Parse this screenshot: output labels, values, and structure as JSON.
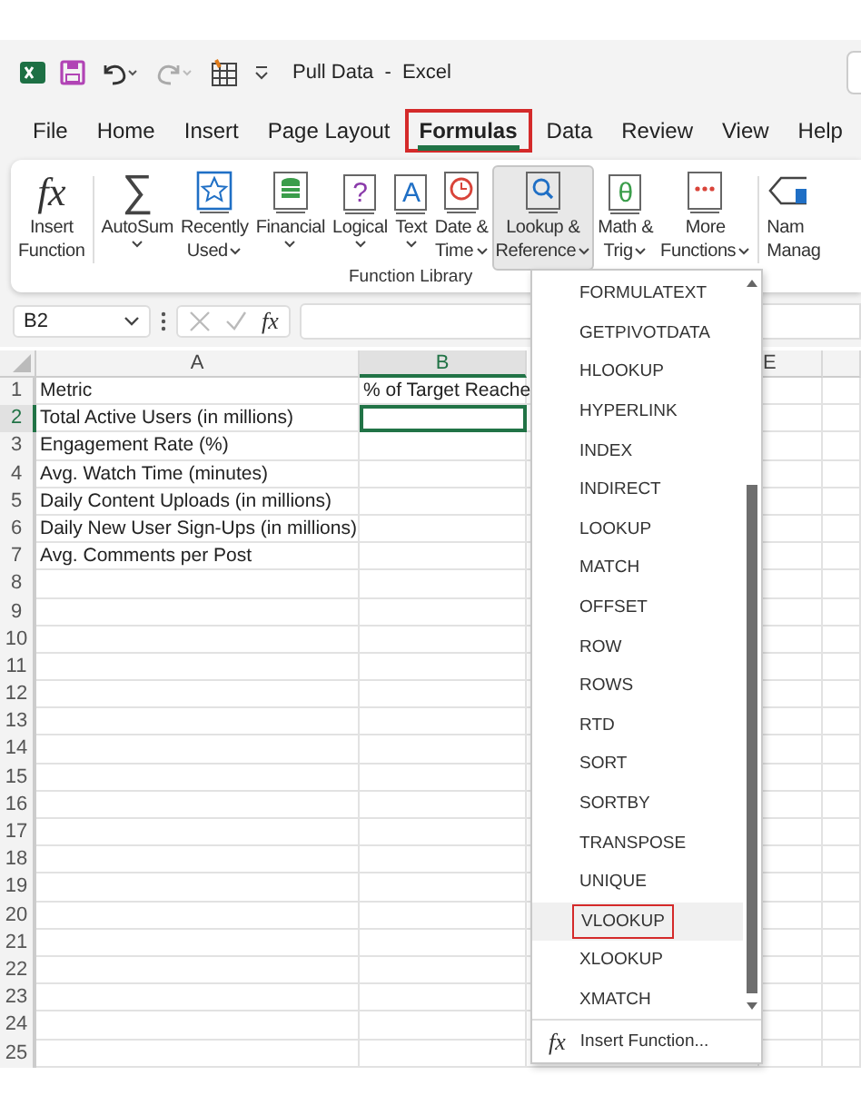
{
  "title_bar": {
    "title": "Pull Data  -  Excel"
  },
  "tabs": [
    {
      "label": "File",
      "selected": false,
      "highlighted": false
    },
    {
      "label": "Home",
      "selected": false,
      "highlighted": false
    },
    {
      "label": "Insert",
      "selected": false,
      "highlighted": false
    },
    {
      "label": "Page Layout",
      "selected": false,
      "highlighted": false
    },
    {
      "label": "Formulas",
      "selected": true,
      "highlighted": true
    },
    {
      "label": "Data",
      "selected": false,
      "highlighted": false
    },
    {
      "label": "Review",
      "selected": false,
      "highlighted": false
    },
    {
      "label": "View",
      "selected": false,
      "highlighted": false
    },
    {
      "label": "Help",
      "selected": false,
      "highlighted": false
    }
  ],
  "ribbon": {
    "group_label": "Function Library",
    "buttons": [
      {
        "kind": "fx",
        "glyph": "fx",
        "lines": [
          "Insert",
          "Function"
        ],
        "dropdown": false,
        "selected": false
      },
      {
        "kind": "sum",
        "glyph": "∑",
        "lines": [
          "AutoSum"
        ],
        "dropdown": true,
        "selected": false
      },
      {
        "kind": "star",
        "lines": [
          "Recently",
          "Used"
        ],
        "dropdown": true,
        "selected": false
      },
      {
        "kind": "db",
        "lines": [
          "Financial"
        ],
        "dropdown": true,
        "selected": false
      },
      {
        "kind": "question",
        "glyph": "?",
        "lines": [
          "Logical"
        ],
        "dropdown": true,
        "selected": false
      },
      {
        "kind": "letter",
        "glyph": "A",
        "lines": [
          "Text"
        ],
        "dropdown": true,
        "selected": false
      },
      {
        "kind": "clock",
        "lines": [
          "Date &",
          "Time"
        ],
        "dropdown": true,
        "selected": false
      },
      {
        "kind": "search",
        "lines": [
          "Lookup &",
          "Reference"
        ],
        "dropdown": true,
        "selected": true
      },
      {
        "kind": "theta",
        "glyph": "θ",
        "lines": [
          "Math &",
          "Trig"
        ],
        "dropdown": true,
        "selected": false
      },
      {
        "kind": "dots",
        "lines": [
          "More",
          "Functions"
        ],
        "dropdown": true,
        "selected": false
      }
    ],
    "cut_button": {
      "lines": [
        "Nam",
        "Manag"
      ]
    }
  },
  "formula_bar": {
    "name_box": "B2",
    "fx": "fx"
  },
  "sheet": {
    "columns": [
      {
        "label": "A",
        "selected": false
      },
      {
        "label": "B",
        "selected": true
      },
      {
        "label": "E",
        "selected": false
      }
    ],
    "rows": [
      {
        "number": "1",
        "selected": false,
        "cells": [
          "Metric",
          "% of Target Reache"
        ]
      },
      {
        "number": "2",
        "selected": true,
        "cells": [
          "Total Active Users (in millions)"
        ]
      },
      {
        "number": "3",
        "selected": false,
        "cells": [
          "Engagement Rate (%)"
        ]
      },
      {
        "number": "4",
        "selected": false,
        "cells": [
          "Avg. Watch Time (minutes)"
        ]
      },
      {
        "number": "5",
        "selected": false,
        "cells": [
          "Daily Content Uploads (in millions)"
        ]
      },
      {
        "number": "6",
        "selected": false,
        "cells": [
          "Daily New User Sign-Ups (in millions)"
        ]
      },
      {
        "number": "7",
        "selected": false,
        "cells": [
          "Avg. Comments per Post"
        ]
      },
      {
        "number": "8",
        "selected": false,
        "cells": []
      },
      {
        "number": "9",
        "selected": false,
        "cells": []
      },
      {
        "number": "10",
        "selected": false,
        "cells": []
      },
      {
        "number": "11",
        "selected": false,
        "cells": []
      },
      {
        "number": "12",
        "selected": false,
        "cells": []
      },
      {
        "number": "13",
        "selected": false,
        "cells": []
      },
      {
        "number": "14",
        "selected": false,
        "cells": []
      },
      {
        "number": "15",
        "selected": false,
        "cells": []
      },
      {
        "number": "16",
        "selected": false,
        "cells": []
      },
      {
        "number": "17",
        "selected": false,
        "cells": []
      },
      {
        "number": "18",
        "selected": false,
        "cells": []
      },
      {
        "number": "19",
        "selected": false,
        "cells": []
      },
      {
        "number": "20",
        "selected": false,
        "cells": []
      },
      {
        "number": "21",
        "selected": false,
        "cells": []
      },
      {
        "number": "22",
        "selected": false,
        "cells": []
      },
      {
        "number": "23",
        "selected": false,
        "cells": []
      },
      {
        "number": "24",
        "selected": false,
        "cells": []
      },
      {
        "number": "25",
        "selected": false,
        "cells": []
      }
    ]
  },
  "dropdown": {
    "items": [
      {
        "label": "FORMULATEXT",
        "selected": false,
        "highlighted": false
      },
      {
        "label": "GETPIVOTDATA",
        "selected": false,
        "highlighted": false
      },
      {
        "label": "HLOOKUP",
        "selected": false,
        "highlighted": false
      },
      {
        "label": "HYPERLINK",
        "selected": false,
        "highlighted": false
      },
      {
        "label": "INDEX",
        "selected": false,
        "highlighted": false
      },
      {
        "label": "INDIRECT",
        "selected": false,
        "highlighted": false
      },
      {
        "label": "LOOKUP",
        "selected": false,
        "highlighted": false
      },
      {
        "label": "MATCH",
        "selected": false,
        "highlighted": false
      },
      {
        "label": "OFFSET",
        "selected": false,
        "highlighted": false
      },
      {
        "label": "ROW",
        "selected": false,
        "highlighted": false
      },
      {
        "label": "ROWS",
        "selected": false,
        "highlighted": false
      },
      {
        "label": "RTD",
        "selected": false,
        "highlighted": false
      },
      {
        "label": "SORT",
        "selected": false,
        "highlighted": false
      },
      {
        "label": "SORTBY",
        "selected": false,
        "highlighted": false
      },
      {
        "label": "TRANSPOSE",
        "selected": false,
        "highlighted": false
      },
      {
        "label": "UNIQUE",
        "selected": false,
        "highlighted": false
      },
      {
        "label": "VLOOKUP",
        "selected": true,
        "highlighted": true
      },
      {
        "label": "XLOOKUP",
        "selected": false,
        "highlighted": false
      },
      {
        "label": "XMATCH",
        "selected": false,
        "highlighted": false
      }
    ],
    "footer": {
      "glyph": "fx",
      "label": "Insert Function..."
    }
  }
}
